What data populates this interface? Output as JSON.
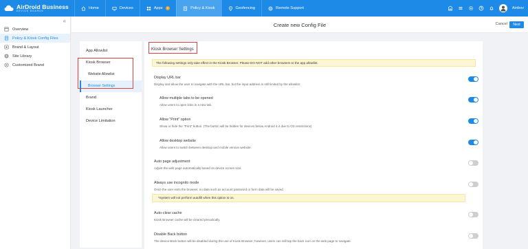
{
  "app": {
    "title": "AirDroid Business",
    "subtitle": "DEVICE BOARDS"
  },
  "nav": {
    "home": "Home",
    "devices": "Devices",
    "apps": "Apps",
    "apps_badge": "1",
    "policy": "Policy & Kiosk",
    "geofencing": "Geofencing",
    "remote": "Remote Support"
  },
  "user": {
    "name": "Airdrov"
  },
  "sidebar": {
    "items": [
      {
        "label": "Overview"
      },
      {
        "label": "Policy & Kiosk Config Files"
      },
      {
        "label": "Brand & Layout"
      },
      {
        "label": "Site Library"
      },
      {
        "label": "Customized Brand"
      }
    ]
  },
  "header": {
    "title": "Create new Config File",
    "cancel": "Cancel",
    "next": "Next"
  },
  "submenu": {
    "app_allowlist": "App Allowlist",
    "kiosk_browser": "Kiosk Browser",
    "website_allowlist": "Website Allowlist",
    "browser_settings": "Browser Settings",
    "brand": "Brand",
    "kiosk_launcher": "Kiosk Launcher",
    "device_limitation": "Device Limitation"
  },
  "main": {
    "section_title": "Kiosk Browser Settings",
    "notice": "The following settings only take effect in the Kiosk Browser. Please DO NOT add other browsers to the app allowlist.",
    "settings": [
      {
        "title": "Display URL bar",
        "desc": "Display and allow the user to navigate with the URL bar, but the input address is still limited by the allowlist.",
        "on": true
      },
      {
        "title": "Allow multiple tabs to be opened",
        "desc": "Allow users to open links in a new tab.",
        "on": true
      },
      {
        "title": "Allow \"Print\" option",
        "desc": "Show or hide the \"Print\" button. (The button will be hidden for devices below Android 4.4 due to OS restrictions)",
        "on": true
      },
      {
        "title": "Allow desktop website",
        "desc": "Allow users to switch between desktop and mobile version website.",
        "on": true
      },
      {
        "title": "Auto page adjustment",
        "desc": "Adjust the web page automatically based on device screen size.",
        "on": false
      },
      {
        "title": "Always use incognito mode",
        "desc": "Once the user exits the browser, no data such as account password or form data will be saved.",
        "on": false
      },
      {
        "title": "Auto-clear cache",
        "desc": "Kiosk Browser cache will be cleared periodically.",
        "on": false
      },
      {
        "title": "Disable Back button",
        "desc": "The device Back button will be disabled during the use of Kiosk Browser; however, users can still tap the back icon on the web page to navigate.",
        "on": false
      }
    ],
    "incognito_warning": "*System will not perform autofill when this option is on."
  },
  "colors": {
    "brand": "#1d8ae8",
    "highlight_box": "#e0413c",
    "notice_bg": "#fdf6d5"
  }
}
